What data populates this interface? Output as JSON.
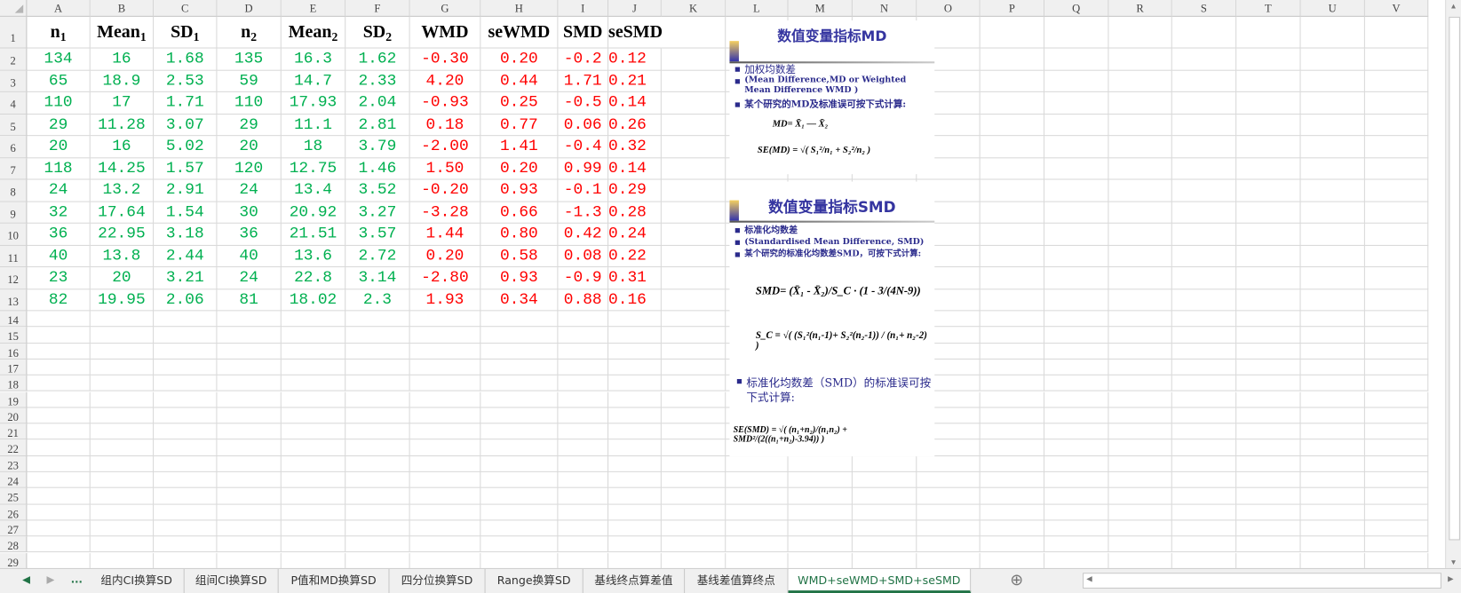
{
  "columns": [
    "A",
    "B",
    "C",
    "D",
    "E",
    "F",
    "G",
    "H",
    "I",
    "J",
    "K",
    "L",
    "M",
    "N",
    "O",
    "P",
    "Q",
    "R",
    "S",
    "T",
    "U",
    "V"
  ],
  "header_row": [
    {
      "base": "n",
      "sub": "1"
    },
    {
      "base": "Mean",
      "sub": "1"
    },
    {
      "base": "SD",
      "sub": "1"
    },
    {
      "base": "n",
      "sub": "2"
    },
    {
      "base": "Mean",
      "sub": "2"
    },
    {
      "base": "SD",
      "sub": "2"
    },
    {
      "base": "WMD",
      "sub": ""
    },
    {
      "base": "seWMD",
      "sub": ""
    },
    {
      "base": "SMD",
      "sub": ""
    },
    {
      "base": "seSMD",
      "sub": ""
    }
  ],
  "rows": [
    [
      "134",
      "16",
      "1.68",
      "135",
      "16.3",
      "1.62",
      "-0.30",
      "0.20",
      "-0.2",
      "0.12"
    ],
    [
      "65",
      "18.9",
      "2.53",
      "59",
      "14.7",
      "2.33",
      "4.20",
      "0.44",
      "1.71",
      "0.21"
    ],
    [
      "110",
      "17",
      "1.71",
      "110",
      "17.93",
      "2.04",
      "-0.93",
      "0.25",
      "-0.5",
      "0.14"
    ],
    [
      "29",
      "11.28",
      "3.07",
      "29",
      "11.1",
      "2.81",
      "0.18",
      "0.77",
      "0.06",
      "0.26"
    ],
    [
      "20",
      "16",
      "5.02",
      "20",
      "18",
      "3.79",
      "-2.00",
      "1.41",
      "-0.4",
      "0.32"
    ],
    [
      "118",
      "14.25",
      "1.57",
      "120",
      "12.75",
      "1.46",
      "1.50",
      "0.20",
      "0.99",
      "0.14"
    ],
    [
      "24",
      "13.2",
      "2.91",
      "24",
      "13.4",
      "3.52",
      "-0.20",
      "0.93",
      "-0.1",
      "0.29"
    ],
    [
      "32",
      "17.64",
      "1.54",
      "30",
      "20.92",
      "3.27",
      "-3.28",
      "0.66",
      "-1.3",
      "0.28"
    ],
    [
      "36",
      "22.95",
      "3.18",
      "36",
      "21.51",
      "3.57",
      "1.44",
      "0.80",
      "0.42",
      "0.24"
    ],
    [
      "40",
      "13.8",
      "2.44",
      "40",
      "13.6",
      "2.72",
      "0.20",
      "0.58",
      "0.08",
      "0.22"
    ],
    [
      "23",
      "20",
      "3.21",
      "24",
      "22.8",
      "3.14",
      "-2.80",
      "0.93",
      "-0.9",
      "0.31"
    ],
    [
      "82",
      "19.95",
      "2.06",
      "81",
      "18.02",
      "2.3",
      "1.93",
      "0.34",
      "0.88",
      "0.16"
    ]
  ],
  "row_numbers": [
    "1",
    "2",
    "3",
    "4",
    "5",
    "6",
    "7",
    "8",
    "9",
    "10",
    "11",
    "12",
    "13",
    "14",
    "15",
    "16",
    "17",
    "18",
    "19",
    "20",
    "21",
    "22",
    "23",
    "24",
    "25",
    "26",
    "27",
    "28",
    "29"
  ],
  "colors": {
    "input": "#00b050",
    "output": "#ff0000",
    "accent": "#217346"
  },
  "md_image": {
    "title": "数值变量指标MD",
    "bullet1": "加权均数差",
    "bullet2": "(Mean Difference,MD  or  Weighted Mean Difference WMD )",
    "bullet3": "某个研究的MD及标准误可按下式计算:",
    "formula1": "MD=  X̄₁ — X̄₂",
    "formula2": "SE(MD) = √( S₁²/n₁ + S₂²/n₂ )"
  },
  "smd_image": {
    "title": "数值变量指标SMD",
    "bullet1": "标准化均数差",
    "bullet2": "(Standardised Mean Difference, SMD)",
    "bullet3": "某个研究的标准化均数差SMD，可按下式计算:",
    "formula1": "SMD= (X̄₁ - X̄₂)/S_C · (1 - 3/(4N-9))",
    "formula2": "S_C = √( (S₁²(n₁-1)+ S₂²(n₂-1)) / (n₁+ n₂-2) )",
    "bullet4": "标准化均数差（SMD）的标准误可按下式计算:",
    "formula3": "SE(SMD) = √( (n₁+n₂)/(n₁n₂) + SMD²/(2((n₁+n₂)-3.94)) )"
  },
  "sheet_tabs": [
    "组内CI换算SD",
    "组间CI换算SD",
    "P值和MD换算SD",
    "四分位换算SD",
    "Range换算SD",
    "基线终点算差值",
    "基线差值算终点",
    "WMD+seWMD+SMD+seSMD"
  ],
  "active_tab": "WMD+seWMD+SMD+seSMD",
  "tab_nav": {
    "prev": "◀",
    "next": "▶",
    "more": "...",
    "add": "⊕"
  }
}
